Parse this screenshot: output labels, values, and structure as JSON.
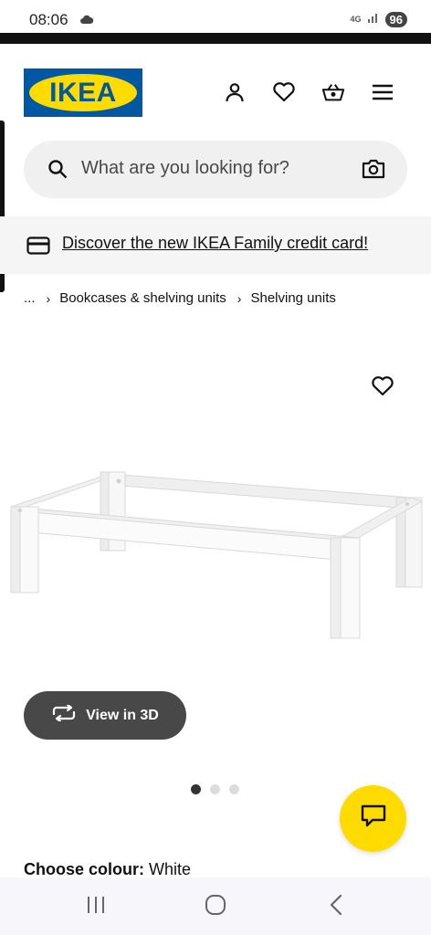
{
  "status_bar": {
    "time": "08:06",
    "network": "4G",
    "battery": "96"
  },
  "header": {
    "logo_text": "IKEA",
    "icons": [
      "profile-icon",
      "heart-icon",
      "basket-icon",
      "menu-icon"
    ]
  },
  "search": {
    "placeholder": "What are you looking for?"
  },
  "banner": {
    "link_text": "Discover the new IKEA Family credit card!"
  },
  "breadcrumb": {
    "ellipsis": "...",
    "items": [
      "Bookcases & shelving units",
      "Shelving units"
    ]
  },
  "product": {
    "view_3d_label": "View in 3D",
    "image_count": 3,
    "active_image": 1,
    "colour_label": "Choose colour:",
    "colour_value": "White"
  },
  "colors": {
    "ikea_blue": "#0058a3",
    "ikea_yellow": "#ffdb00",
    "button_dark": "#484848"
  }
}
